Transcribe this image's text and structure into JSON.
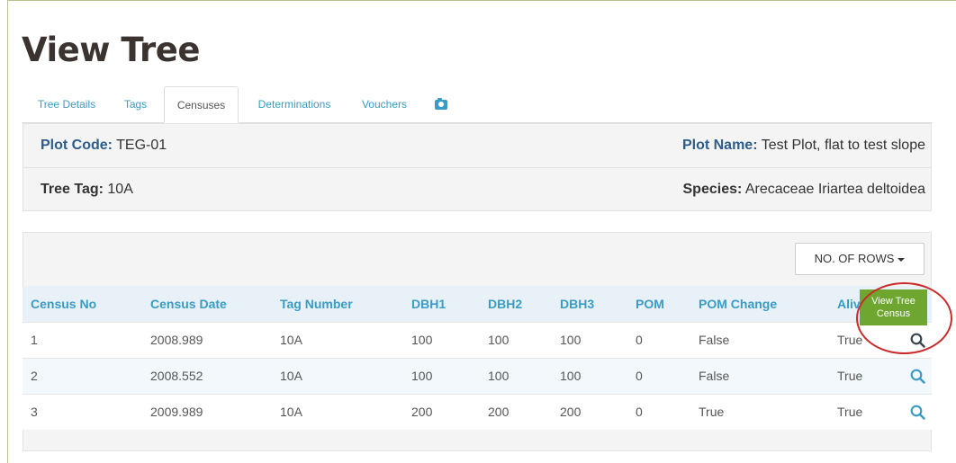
{
  "page": {
    "title": "View Tree"
  },
  "tabs": [
    {
      "label": "Tree Details"
    },
    {
      "label": "Tags"
    },
    {
      "label": "Censuses"
    },
    {
      "label": "Determinations"
    },
    {
      "label": "Vouchers"
    },
    {
      "label": "",
      "icon": "camera-icon"
    }
  ],
  "active_tab": "Censuses",
  "info": {
    "plot_code_label": "Plot Code:",
    "plot_code": "TEG-01",
    "plot_name_label": "Plot Name:",
    "plot_name": "Test Plot, flat to test slope",
    "tree_tag_label": "Tree Tag:",
    "tree_tag": "10A",
    "species_label": "Species:",
    "species": "Arecaceae Iriartea deltoidea"
  },
  "rows_button": {
    "label": "NO. OF ROWS"
  },
  "table": {
    "headers": [
      "Census No",
      "Census Date",
      "Tag Number",
      "DBH1",
      "DBH2",
      "DBH3",
      "POM",
      "POM Change",
      "Aliv"
    ],
    "rows": [
      [
        "1",
        "2008.989",
        "10A",
        "100",
        "100",
        "100",
        "0",
        "False",
        "True"
      ],
      [
        "2",
        "2008.552",
        "10A",
        "100",
        "100",
        "100",
        "0",
        "False",
        "True"
      ],
      [
        "3",
        "2009.989",
        "10A",
        "200",
        "200",
        "200",
        "0",
        "True",
        "True"
      ]
    ]
  },
  "tooltip": {
    "line1": "View Tree",
    "line2": "Census"
  },
  "colors": {
    "link": "#3a9bc4",
    "tooltip": "#6ea62f",
    "highlight": "#cc2a2a",
    "header_bg": "#e8f1f8"
  }
}
